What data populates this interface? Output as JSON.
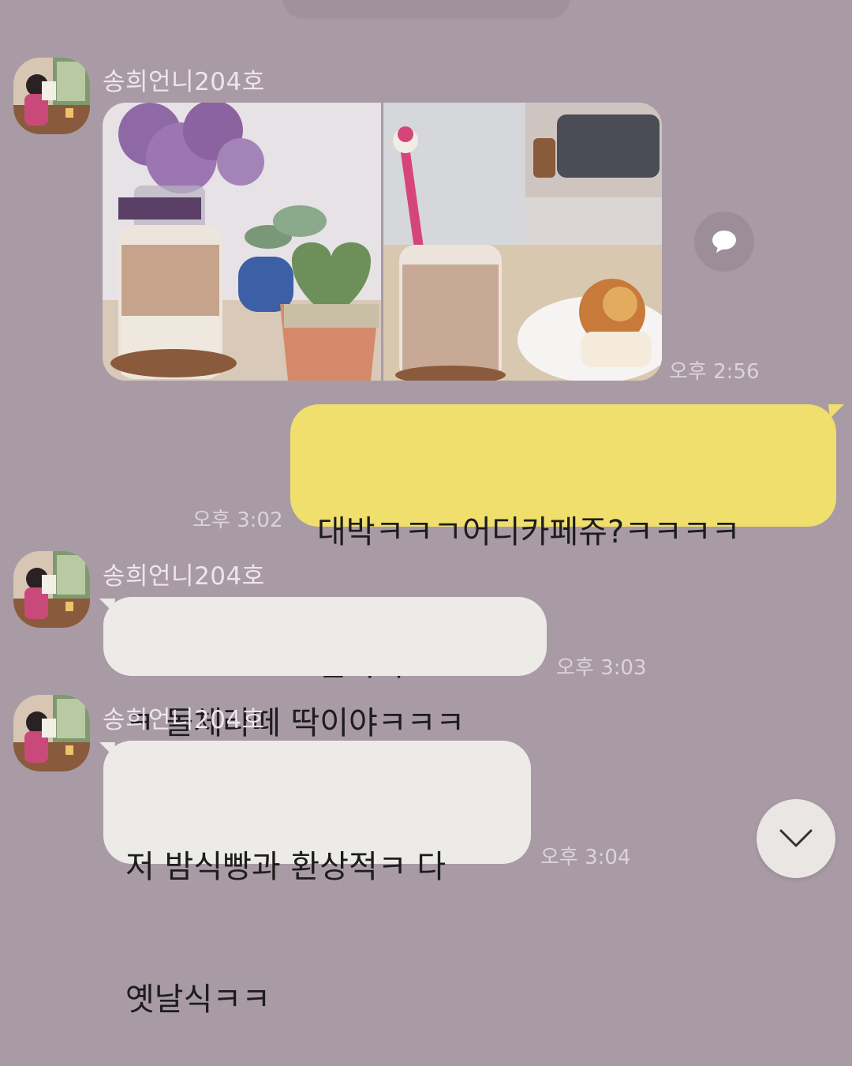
{
  "chat": {
    "messages": [
      {
        "sender": "송희언니204호",
        "type": "photos",
        "photos": [
          "iced-latte-flowers-photo",
          "iced-latte-bread-photo"
        ],
        "time": "오후 2:56"
      },
      {
        "sender": "me",
        "type": "text",
        "lines": [
          "대박ㅋㅋㄱ어디카페쥬?ㅋㅋㅋㅋ",
          "빈티지"
        ],
        "time": "오후 3:02"
      },
      {
        "sender": "송희언니204호",
        "type": "text",
        "lines": [
          "ㅋ 돌체라떼 딱이야ㅋㅋㅋ"
        ],
        "time": "오후 3:03"
      },
      {
        "sender": "송희언니204호",
        "type": "text",
        "lines": [
          "저 밤식빵과 환상적ㅋ 다",
          "옛날식ㅋㅋ"
        ],
        "time": "오후 3:04"
      }
    ]
  },
  "icons": {
    "share": "speech-bubble-icon",
    "scroll": "chevron-down-icon"
  },
  "colors": {
    "background": "#a99ba6",
    "incoming_bubble": "#ecebe8",
    "outgoing_bubble": "#f0df6c",
    "meta_text": "#ddd3da"
  }
}
